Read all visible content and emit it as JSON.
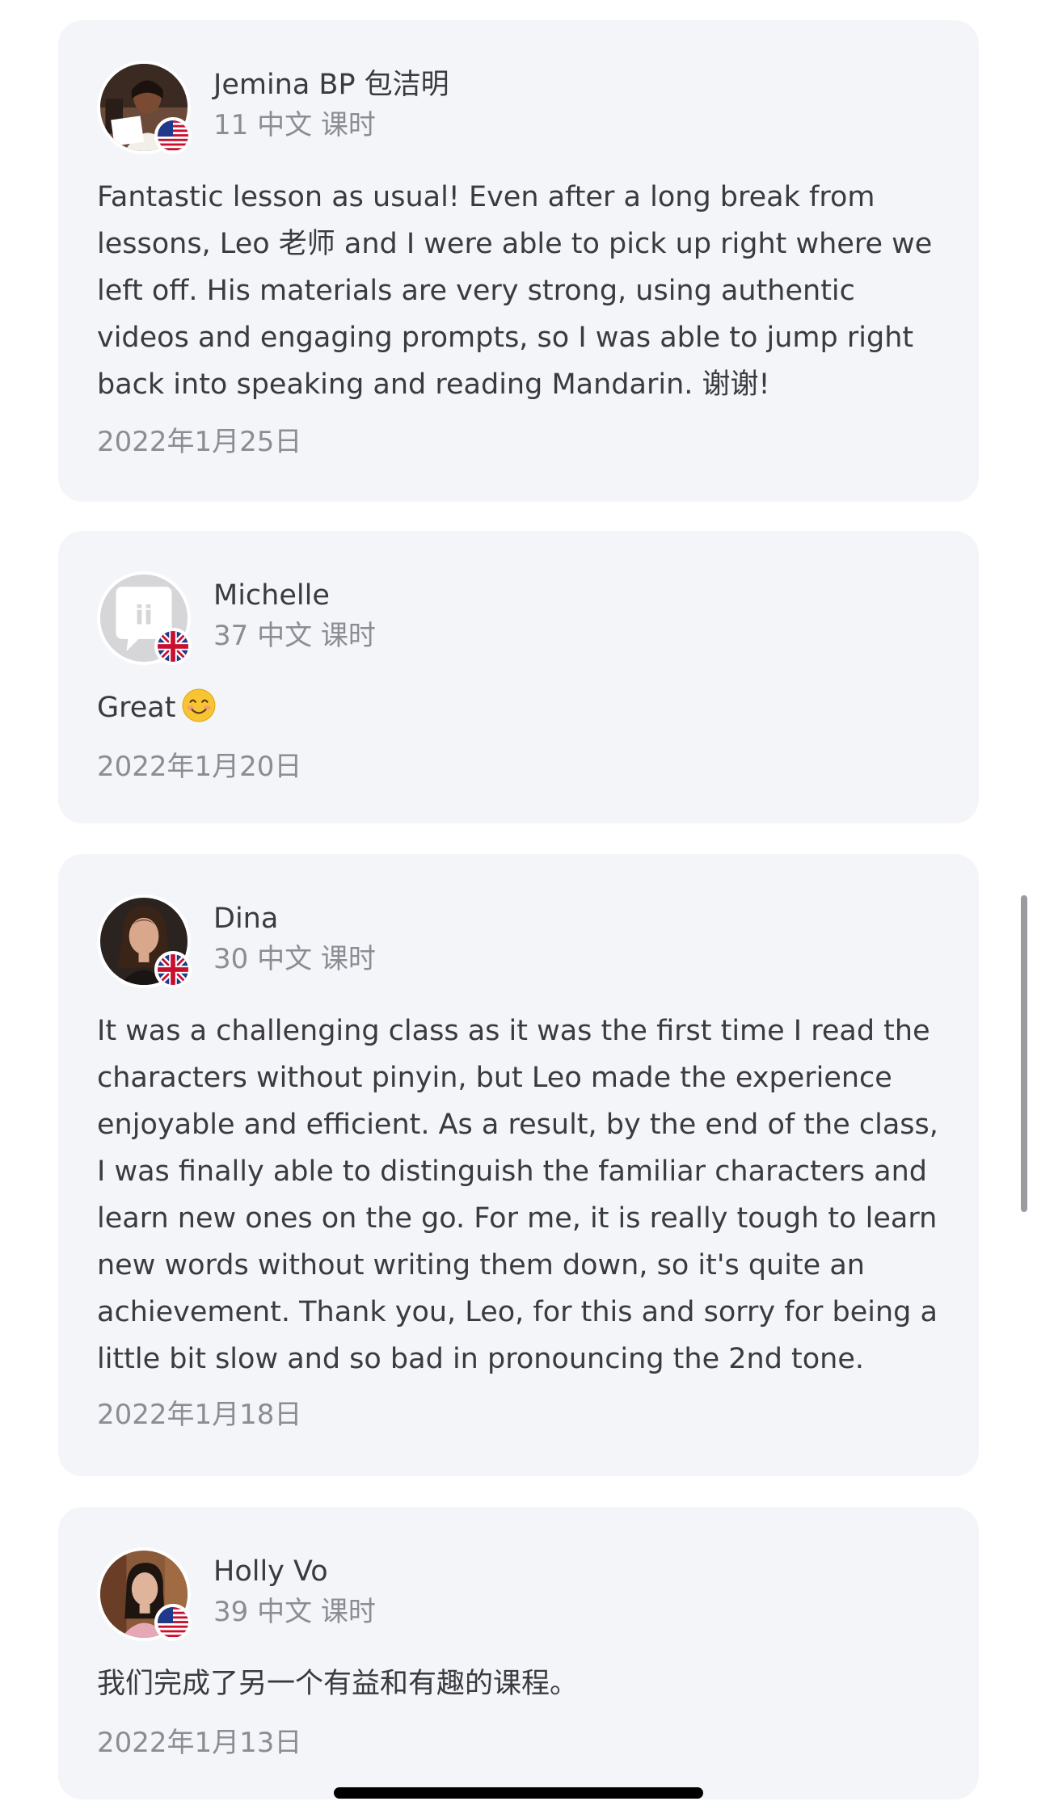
{
  "reviews": [
    {
      "name": "Jemina BP 包洁明",
      "lessons": "11 中文 课时",
      "flag": "us-flag-icon",
      "avatar": "photo-avatar",
      "text": "Fantastic lesson as usual! Even after a long break from lessons, Leo 老师 and I were able to pick up right where we left off. His materials are very strong, using authentic videos and engaging prompts, so I was able to jump right back into speaking and reading Mandarin. 谢谢!",
      "date": "2022年1月25日"
    },
    {
      "name": "Michelle",
      "lessons": "37 中文 课时",
      "flag": "uk-flag-icon",
      "avatar": "default-avatar",
      "avatar_glyph": "ii",
      "text": "Great",
      "emoji": "smiling-face-emoji",
      "date": "2022年1月20日"
    },
    {
      "name": "Dina",
      "lessons": "30 中文 课时",
      "flag": "uk-flag-icon",
      "avatar": "photo-avatar",
      "text": "It was a challenging class as it was the first time I read the characters without pinyin, but Leo made the experience enjoyable and efficient. As a result, by the end of the class, I was finally able to distinguish the familiar characters and learn new ones on the go. For me, it is really tough to learn new words without writing them down, so it's quite an achievement. Thank you, Leo, for this and sorry for being a little bit slow and so bad in pronouncing the 2nd tone.",
      "date": "2022年1月18日"
    },
    {
      "name": "Holly Vo",
      "lessons": "39 中文 课时",
      "flag": "us-flag-icon",
      "avatar": "photo-avatar",
      "text": "我们完成了另一个有益和有趣的课程。",
      "date": "2022年1月13日"
    }
  ],
  "colors": {
    "card_bg": "#f4f5f8",
    "text_primary": "#3a3a3f",
    "text_secondary": "#8c8c95"
  }
}
